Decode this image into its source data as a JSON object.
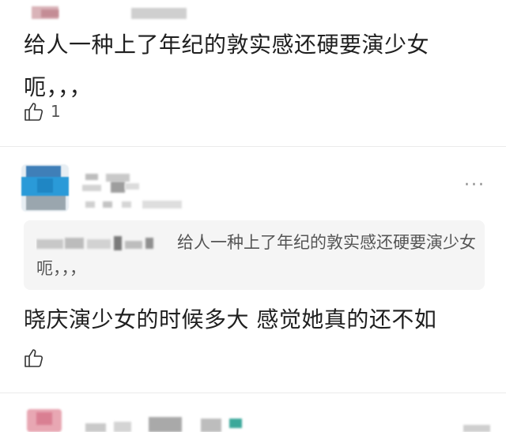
{
  "comments": [
    {
      "text": "给人一种上了年纪的敦实感还硬要演少女呃，，，",
      "like_count": "1"
    },
    {
      "quote": {
        "text": "给人一种上了年纪的敦实感还硬要演少女呃，，，"
      },
      "text": "晓庆演少女的时候多大 感觉她真的还不如",
      "more_label": "···"
    }
  ],
  "colors": {
    "text": "#1f1f1f",
    "muted": "#555555",
    "quote_bg": "#f5f5f5",
    "divider": "#ebebeb",
    "avatar_accent": "#2a9ad8"
  },
  "icons": [
    "thumbs-up-icon",
    "more-dots-icon"
  ]
}
